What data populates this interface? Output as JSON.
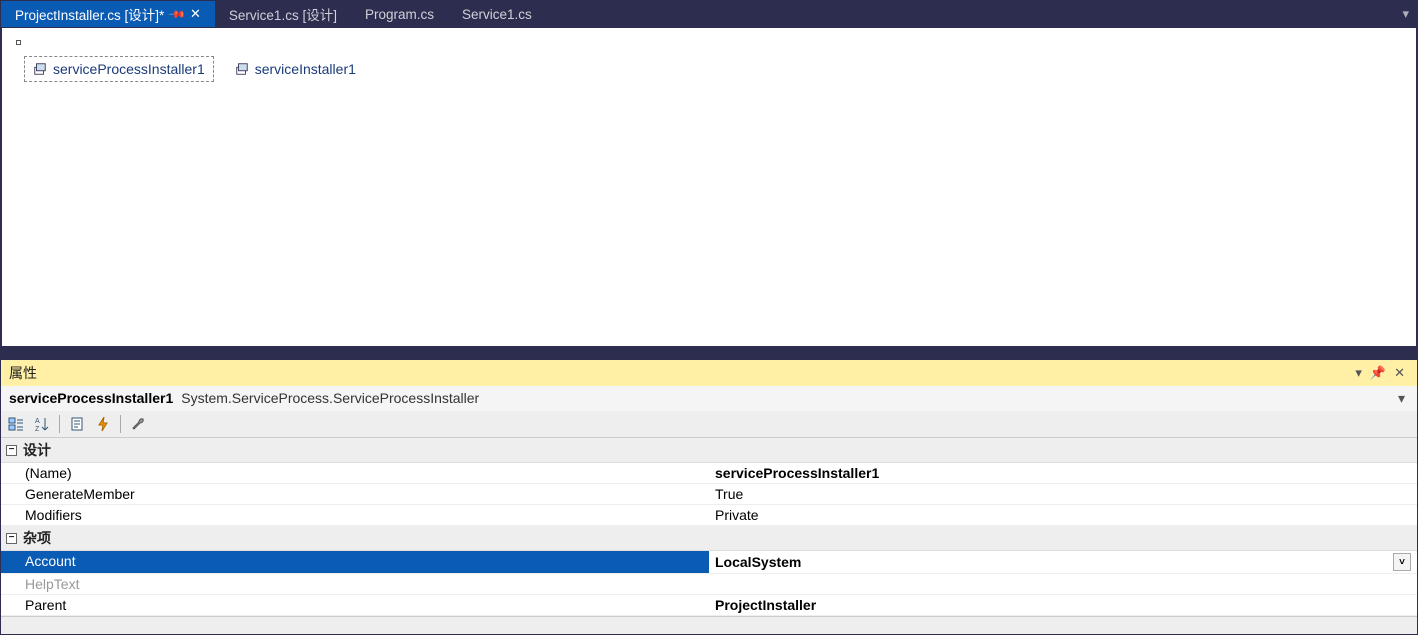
{
  "tabs": [
    {
      "label": "ProjectInstaller.cs [设计]*",
      "active": true,
      "pinned": true,
      "closeable": true
    },
    {
      "label": "Service1.cs [设计]",
      "active": false
    },
    {
      "label": "Program.cs",
      "active": false
    },
    {
      "label": "Service1.cs",
      "active": false
    }
  ],
  "designer": {
    "components": [
      {
        "label": "serviceProcessInstaller1",
        "selected": true
      },
      {
        "label": "serviceInstaller1",
        "selected": false
      }
    ]
  },
  "properties": {
    "panel_title": "属性",
    "object_name": "serviceProcessInstaller1",
    "object_type": "System.ServiceProcess.ServiceProcessInstaller",
    "categories": [
      {
        "label": "设计",
        "rows": [
          {
            "name": "(Name)",
            "value": "serviceProcessInstaller1",
            "bold": true
          },
          {
            "name": "GenerateMember",
            "value": "True"
          },
          {
            "name": "Modifiers",
            "value": "Private"
          }
        ]
      },
      {
        "label": "杂项",
        "rows": [
          {
            "name": "Account",
            "value": "LocalSystem",
            "bold": true,
            "selected": true,
            "dropdown": true
          },
          {
            "name": "HelpText",
            "value": "",
            "disabled": true
          },
          {
            "name": "Parent",
            "value": "ProjectInstaller",
            "bold": true
          }
        ]
      }
    ]
  },
  "icons": {
    "pin": "⇲",
    "close": "✕",
    "dropdown": "▾",
    "expander_minus": "−"
  }
}
